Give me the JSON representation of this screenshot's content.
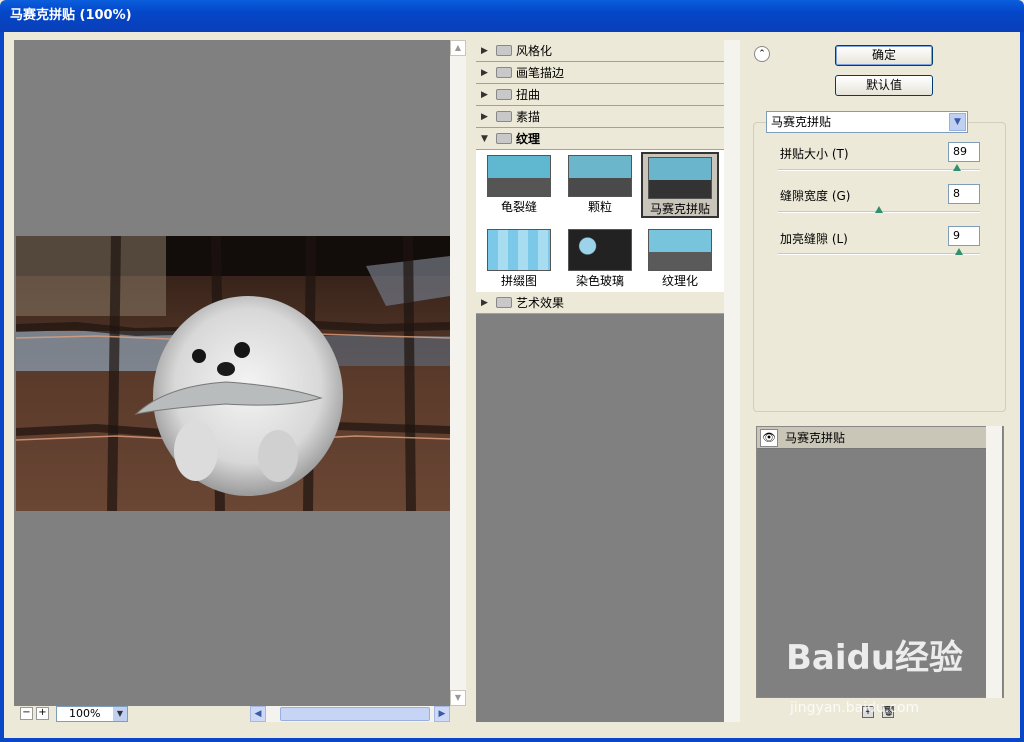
{
  "window": {
    "title": "马赛克拼贴 (100%)"
  },
  "preview": {
    "zoom": "100%"
  },
  "gallery": {
    "categories": [
      {
        "label": "风格化",
        "open": false
      },
      {
        "label": "画笔描边",
        "open": false
      },
      {
        "label": "扭曲",
        "open": false
      },
      {
        "label": "素描",
        "open": false
      },
      {
        "label": "纹理",
        "open": true
      },
      {
        "label": "艺术效果",
        "open": false
      }
    ],
    "texture_filters": [
      {
        "label": "龟裂缝",
        "icon": "craquelure-thumb",
        "selected": false
      },
      {
        "label": "颗粒",
        "icon": "grain-thumb",
        "selected": false
      },
      {
        "label": "马赛克拼贴",
        "icon": "mosaic-tiles-thumb",
        "selected": true
      },
      {
        "label": "拼缀图",
        "icon": "patchwork-thumb",
        "selected": false
      },
      {
        "label": "染色玻璃",
        "icon": "stained-glass-thumb",
        "selected": false
      },
      {
        "label": "纹理化",
        "icon": "texturizer-thumb",
        "selected": false
      }
    ]
  },
  "buttons": {
    "ok": "确定",
    "default": "默认值"
  },
  "settings": {
    "filter": "马赛克拼贴",
    "params": [
      {
        "label": "拼贴大小 (T)",
        "value": "89",
        "fraction": 0.89
      },
      {
        "label": "缝隙宽度 (G)",
        "value": "8",
        "fraction": 0.5
      },
      {
        "label": "加亮缝隙 (L)",
        "value": "9",
        "fraction": 0.9
      }
    ]
  },
  "layers": {
    "items": [
      {
        "label": "马赛克拼贴"
      }
    ]
  },
  "watermark": {
    "text": "Baidu经验",
    "sub": "jingyan.baidu.com"
  }
}
